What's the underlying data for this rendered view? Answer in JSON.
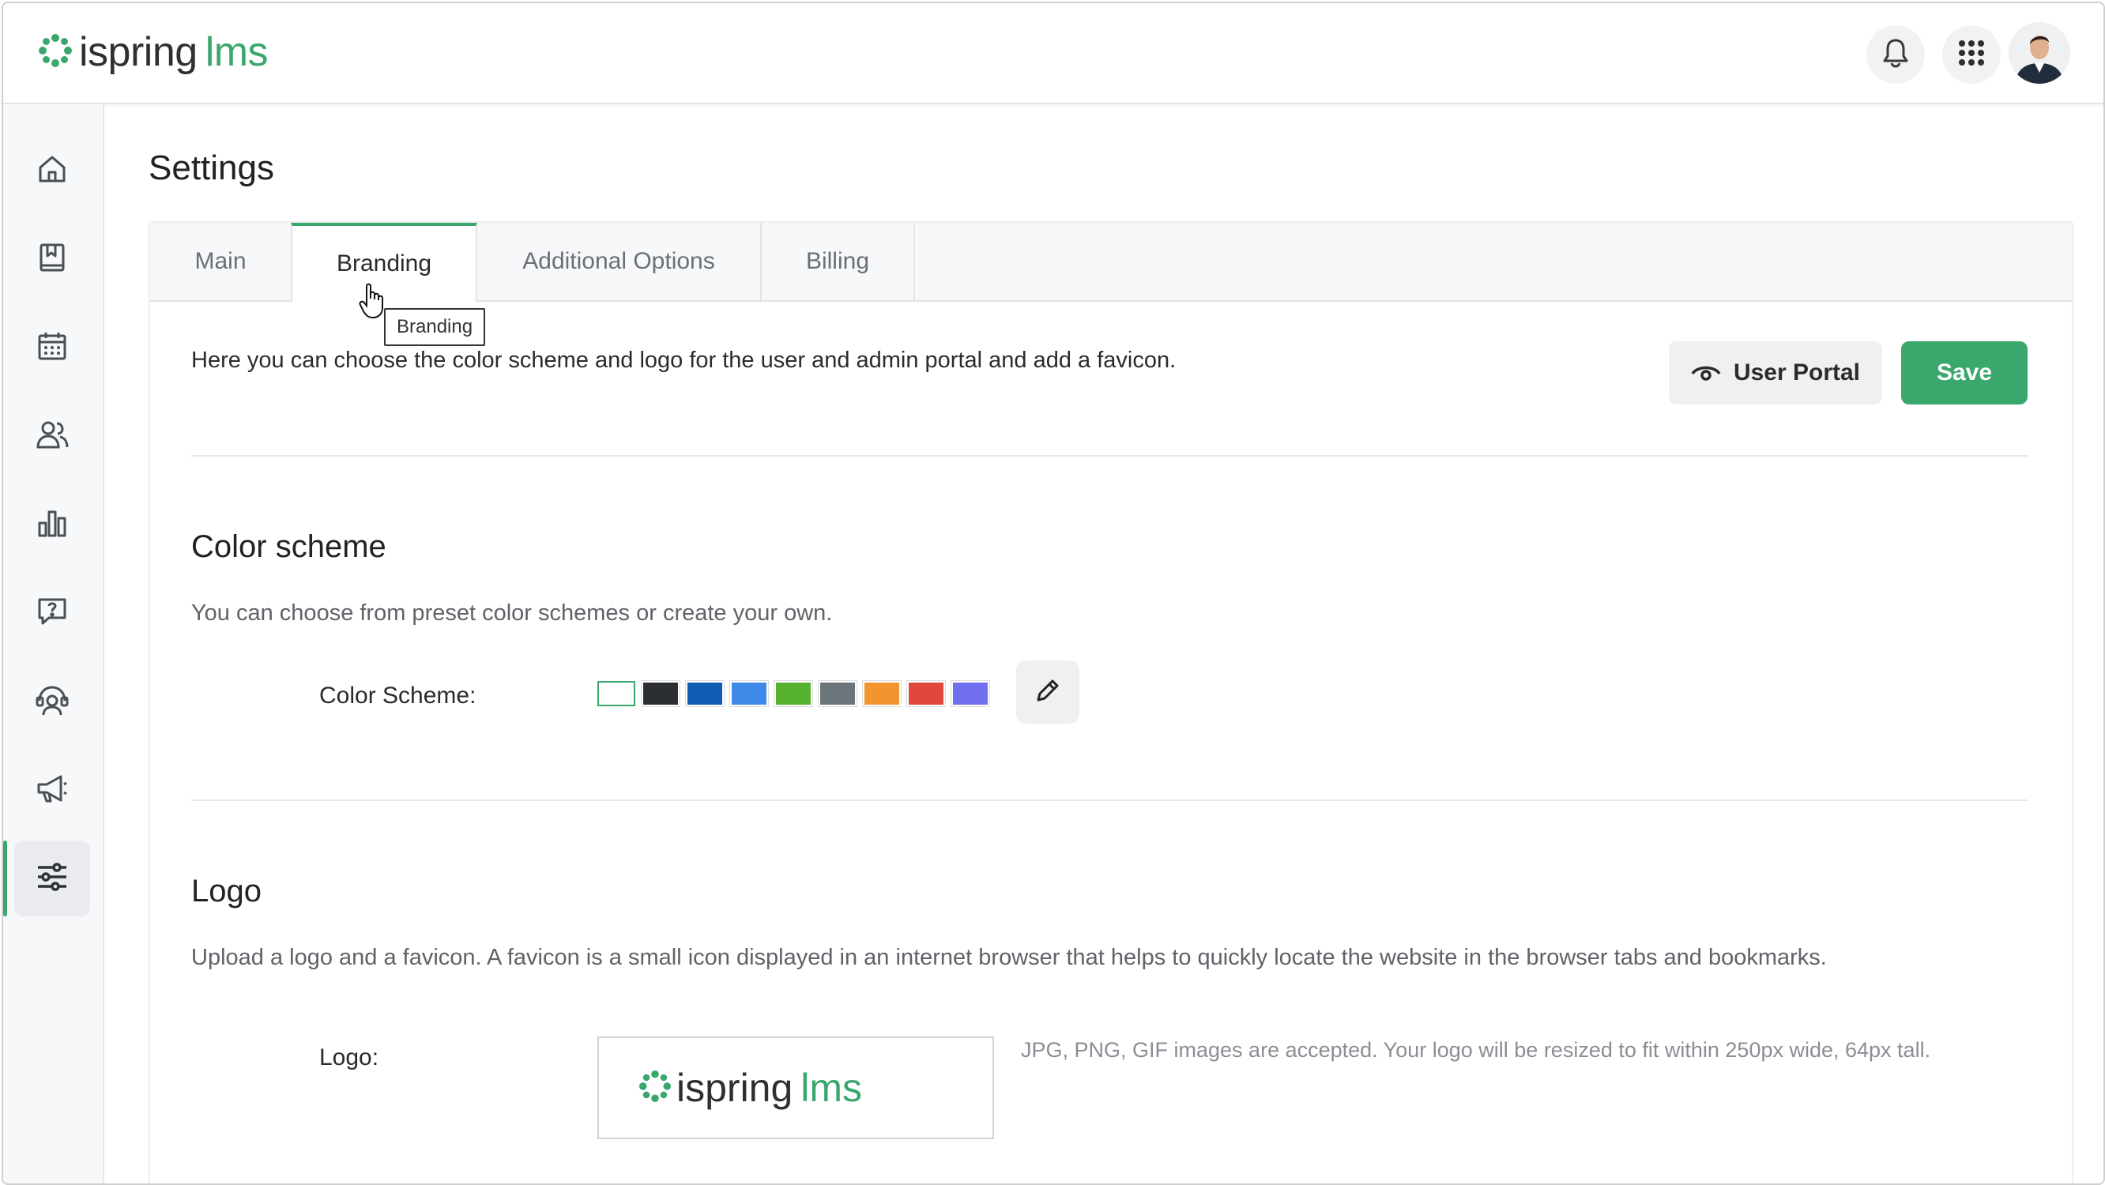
{
  "header": {
    "logo_word1": "ispring",
    "logo_word2": "lms",
    "bell_icon": "bell-icon",
    "apps_icon": "apps-grid-icon"
  },
  "sidebar": {
    "items": [
      {
        "icon": "home-icon"
      },
      {
        "icon": "book-icon"
      },
      {
        "icon": "calendar-icon"
      },
      {
        "icon": "users-icon"
      },
      {
        "icon": "reports-icon"
      },
      {
        "icon": "questions-icon"
      },
      {
        "icon": "support-icon"
      },
      {
        "icon": "megaphone-icon"
      },
      {
        "icon": "settings-sliders-icon",
        "active": true
      }
    ]
  },
  "page": {
    "title": "Settings",
    "tabs": [
      {
        "label": "Main"
      },
      {
        "label": "Branding",
        "active": true
      },
      {
        "label": "Additional Options"
      },
      {
        "label": "Billing"
      }
    ],
    "tooltip": "Branding",
    "intro": "Here you can choose the color scheme and logo for the user and admin portal and add a favicon.",
    "user_portal_label": "User Portal",
    "save_label": "Save"
  },
  "color_scheme": {
    "title": "Color scheme",
    "description": "You can choose from preset color schemes or create your own.",
    "field_label": "Color Scheme:",
    "swatches": [
      "#ffffff",
      "#2b2e33",
      "#0f5db3",
      "#3f8ae8",
      "#56b22e",
      "#6a7479",
      "#f2952f",
      "#e0463b",
      "#6f6ff0"
    ],
    "selected_index": 0
  },
  "logo": {
    "title": "Logo",
    "description": "Upload a logo and a favicon. A favicon is a small icon displayed in an internet browser that helps to quickly locate the website in the browser tabs and bookmarks.",
    "field_label": "Logo:",
    "preview_word1": "ispring",
    "preview_word2": "lms",
    "hint": "JPG, PNG, GIF images are accepted. Your logo will be resized to fit within 250px wide, 64px tall."
  },
  "colors": {
    "accent": "#3aa76d"
  }
}
